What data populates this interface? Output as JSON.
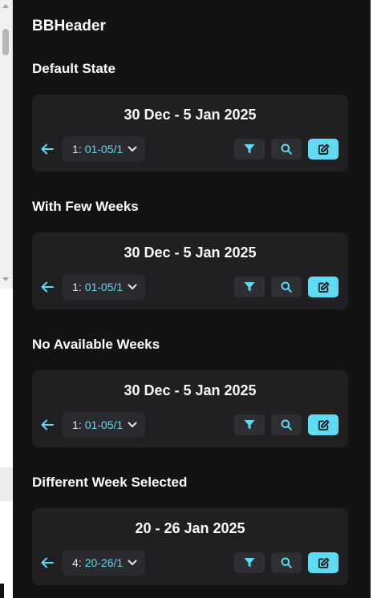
{
  "page": {
    "title": "BBHeader"
  },
  "sections": [
    {
      "title": "Default State",
      "date_label": "30 Dec - 5 Jan 2025",
      "week_num": "1:",
      "week_range": "01-05/1"
    },
    {
      "title": "With Few Weeks",
      "date_label": "30 Dec - 5 Jan 2025",
      "week_num": "1:",
      "week_range": "01-05/1"
    },
    {
      "title": "No Available Weeks",
      "date_label": "30 Dec - 5 Jan 2025",
      "week_num": "1:",
      "week_range": "01-05/1"
    },
    {
      "title": "Different Week Selected",
      "date_label": "20 - 26 Jan 2025",
      "week_num": "4:",
      "week_range": "20-26/1"
    }
  ],
  "icons": {
    "back": "arrow-left-icon",
    "dropdown": "chevron-down-icon",
    "filter": "filter-icon",
    "search": "search-icon",
    "edit": "edit-icon"
  },
  "colors": {
    "background": "#131316",
    "card": "#202023",
    "accent": "#5fdcf3",
    "accent_text": "#5fd8f0"
  }
}
